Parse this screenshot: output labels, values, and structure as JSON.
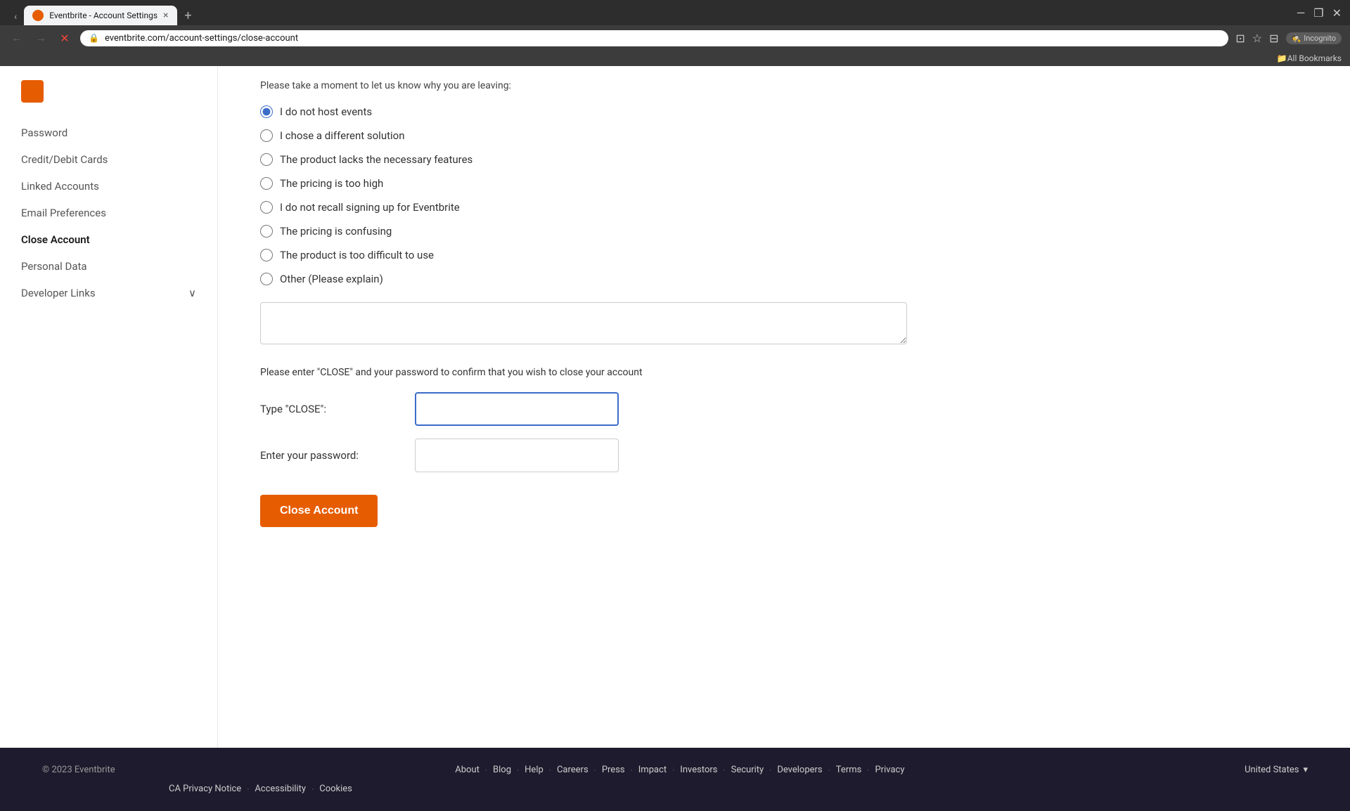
{
  "browser": {
    "tab_title": "Eventbrite - Account Settings",
    "tab_close": "×",
    "tab_new": "+",
    "window_minimize": "—",
    "window_maximize": "❐",
    "window_close": "✕",
    "address": "eventbrite.com/account-settings/close-account",
    "nav_back": "←",
    "nav_forward": "→",
    "nav_reload": "✕",
    "incognito_label": "Incognito",
    "bookmarks_label": "All Bookmarks"
  },
  "sidebar": {
    "items": [
      {
        "id": "password",
        "label": "Password"
      },
      {
        "id": "credit-cards",
        "label": "Credit/Debit Cards"
      },
      {
        "id": "linked-accounts",
        "label": "Linked Accounts"
      },
      {
        "id": "email-preferences",
        "label": "Email Preferences"
      },
      {
        "id": "close-account",
        "label": "Close Account",
        "active": true
      },
      {
        "id": "personal-data",
        "label": "Personal Data"
      },
      {
        "id": "developer-links",
        "label": "Developer Links"
      }
    ],
    "developer_chevron": "∨"
  },
  "main": {
    "intro_text": "Please take a moment to let us know why you are leaving:",
    "radio_options": [
      {
        "id": "no-host",
        "label": "I do not host events",
        "checked": true
      },
      {
        "id": "different-solution",
        "label": "I chose a different solution",
        "checked": false
      },
      {
        "id": "lacks-features",
        "label": "The product lacks the necessary features",
        "checked": false
      },
      {
        "id": "too-high",
        "label": "The pricing is too high",
        "checked": false
      },
      {
        "id": "no-recall",
        "label": "I do not recall signing up for Eventbrite",
        "checked": false
      },
      {
        "id": "confusing",
        "label": "The pricing is confusing",
        "checked": false
      },
      {
        "id": "difficult",
        "label": "The product is too difficult to use",
        "checked": false
      },
      {
        "id": "other",
        "label": "Other (Please explain)",
        "checked": false
      }
    ],
    "textarea_placeholder": "",
    "confirm_description": "Please enter \"CLOSE\" and your password to confirm that you wish to close your account",
    "close_label": "Type \"CLOSE\":",
    "close_value": "",
    "password_label": "Enter your password:",
    "password_value": "",
    "close_button": "Close Account"
  },
  "footer": {
    "copyright": "© 2023 Eventbrite",
    "links": [
      {
        "label": "About"
      },
      {
        "label": "Blog"
      },
      {
        "label": "Help"
      },
      {
        "label": "Careers"
      },
      {
        "label": "Press"
      },
      {
        "label": "Impact"
      },
      {
        "label": "Investors"
      },
      {
        "label": "Security"
      },
      {
        "label": "Developers"
      },
      {
        "label": "Terms"
      },
      {
        "label": "Privacy"
      }
    ],
    "secondary_links": [
      {
        "label": "CA Privacy Notice"
      },
      {
        "label": "Accessibility"
      },
      {
        "label": "Cookies"
      }
    ],
    "region": "United States",
    "region_arrow": "▾"
  }
}
